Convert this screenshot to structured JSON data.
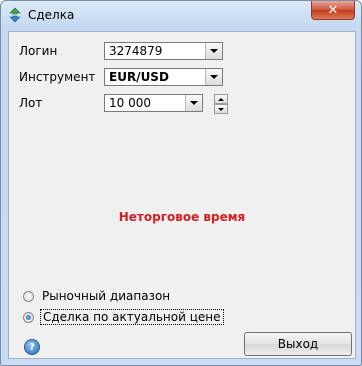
{
  "window": {
    "title": "Сделка",
    "close_glyph": "✕",
    "help_glyph": "?"
  },
  "form": {
    "login_label": "Логин",
    "login_value": "3274879",
    "instrument_label": "Инструмент",
    "instrument_value": "EUR/USD",
    "lot_label": "Лот",
    "lot_value": "10 000"
  },
  "status_text": "Неторговое время",
  "status_color": "#d21f1f",
  "radios": [
    {
      "label": "Рыночный диапазон",
      "selected": false
    },
    {
      "label": "Сделка по актуальной цене",
      "selected": true
    }
  ],
  "buttons": {
    "exit_label": "Выход"
  },
  "icons": {
    "app": "green-arrows-icon",
    "help": "help-icon",
    "close": "close-icon"
  }
}
